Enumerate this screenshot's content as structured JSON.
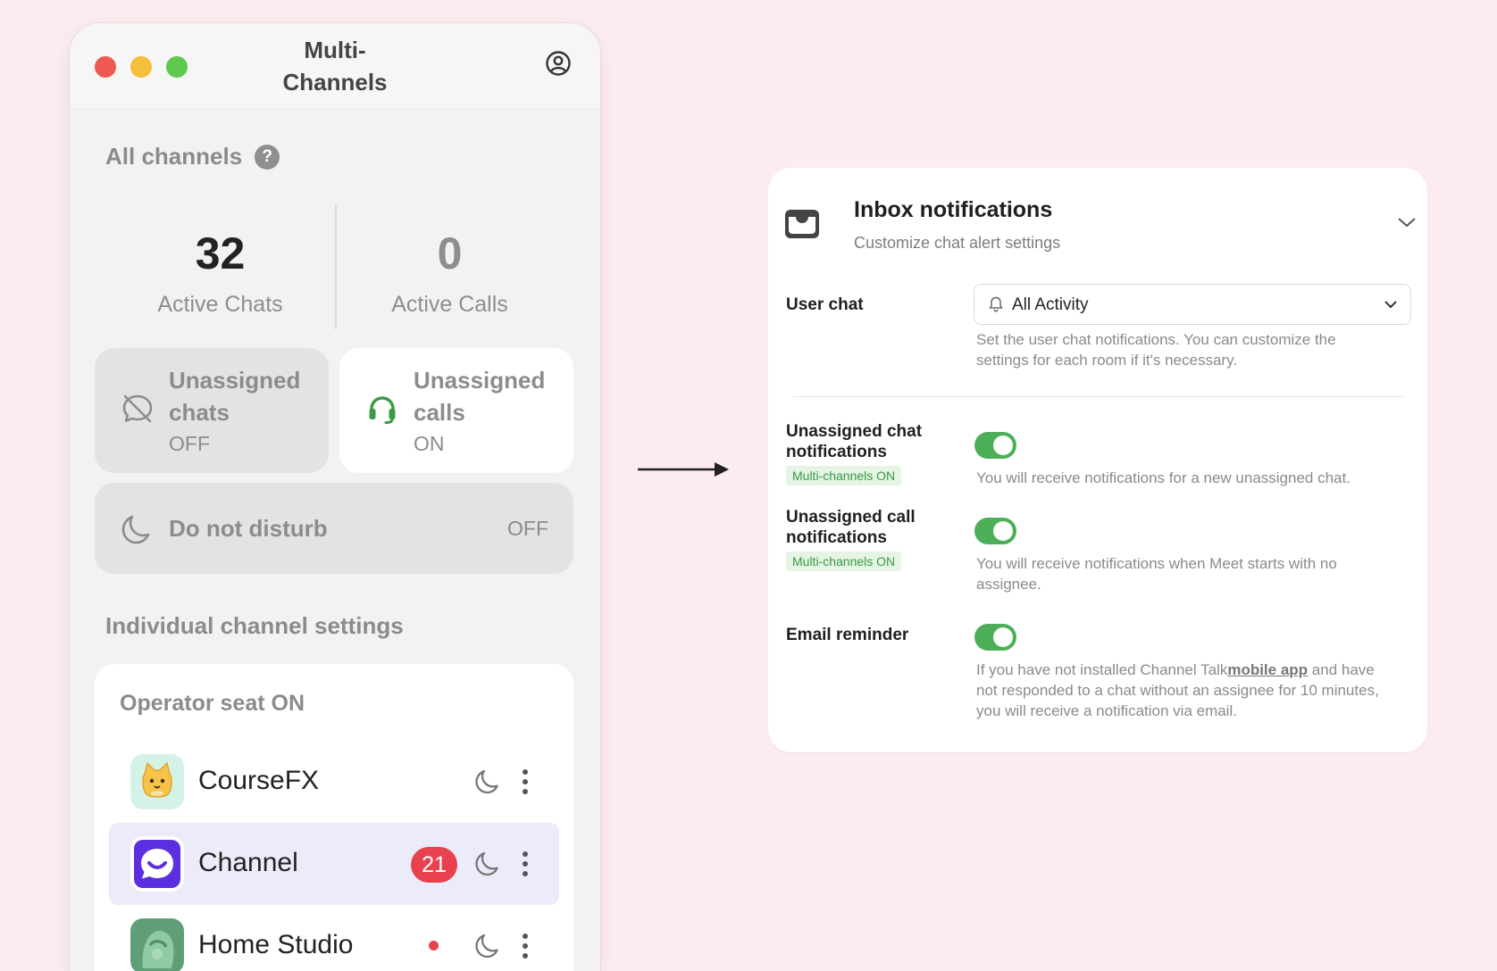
{
  "window": {
    "title_line1": "Multi-",
    "title_line2": "Channels",
    "traffic_lights": [
      "#ee5a52",
      "#f5bf3a",
      "#5fc84f"
    ]
  },
  "all_channels": {
    "title": "All channels",
    "help_glyph": "?",
    "active_chats": {
      "value": "32",
      "label": "Active Chats"
    },
    "active_calls": {
      "value": "0",
      "label": "Active Calls"
    }
  },
  "toggles": {
    "unassigned_chats": {
      "line1": "Unassigned",
      "line2": "chats",
      "state": "OFF",
      "icon": "chat-off-icon"
    },
    "unassigned_calls": {
      "line1": "Unassigned",
      "line2": "calls",
      "state": "ON",
      "icon": "headset-icon"
    },
    "do_not_disturb": {
      "label": "Do not disturb",
      "state": "OFF",
      "icon": "moon-icon"
    }
  },
  "individual": {
    "title": "Individual channel settings",
    "group_title": "Operator seat ON",
    "channels": [
      {
        "name": "CourseFX",
        "icon": "cat-avatar",
        "badge": ""
      },
      {
        "name": "Channel",
        "icon": "channel-logo-avatar",
        "badge": "21"
      },
      {
        "name": "Home Studio",
        "icon": "studio-avatar",
        "badge": ""
      }
    ]
  },
  "panel": {
    "title": "Inbox notifications",
    "subtitle": "Customize chat alert settings",
    "user_chat": {
      "label": "User chat",
      "select_value": "All Activity",
      "desc_line1": "Set the user chat notifications. You can customize the",
      "desc_line2": "settings for each room if it's necessary."
    },
    "unassigned_chat": {
      "label_line1": "Unassigned chat",
      "label_line2": "notifications",
      "tag": "Multi-channels ON",
      "enabled": true,
      "desc": "You will receive notifications for a new unassigned chat."
    },
    "unassigned_call": {
      "label_line1": "Unassigned call",
      "label_line2": "notifications",
      "tag": "Multi-channels ON",
      "enabled": true,
      "desc_line1": "You will receive notifications when Meet starts with no",
      "desc_line2": "assignee."
    },
    "email_reminder": {
      "label": "Email reminder",
      "enabled": true,
      "desc_prefix": "If you have not installed Channel Talk",
      "desc_link": "mobile app",
      "desc_suffix": " and have",
      "desc_line2": "not responded to a chat without an assignee for 10 minutes,",
      "desc_line3": "you will receive a notification via email."
    }
  },
  "colors": {
    "background": "#fdecef",
    "toggle_on": "#4caf58",
    "badge": "#e8424f",
    "calls_icon": "#3a9a45",
    "selected_row": "#ecebfa"
  }
}
